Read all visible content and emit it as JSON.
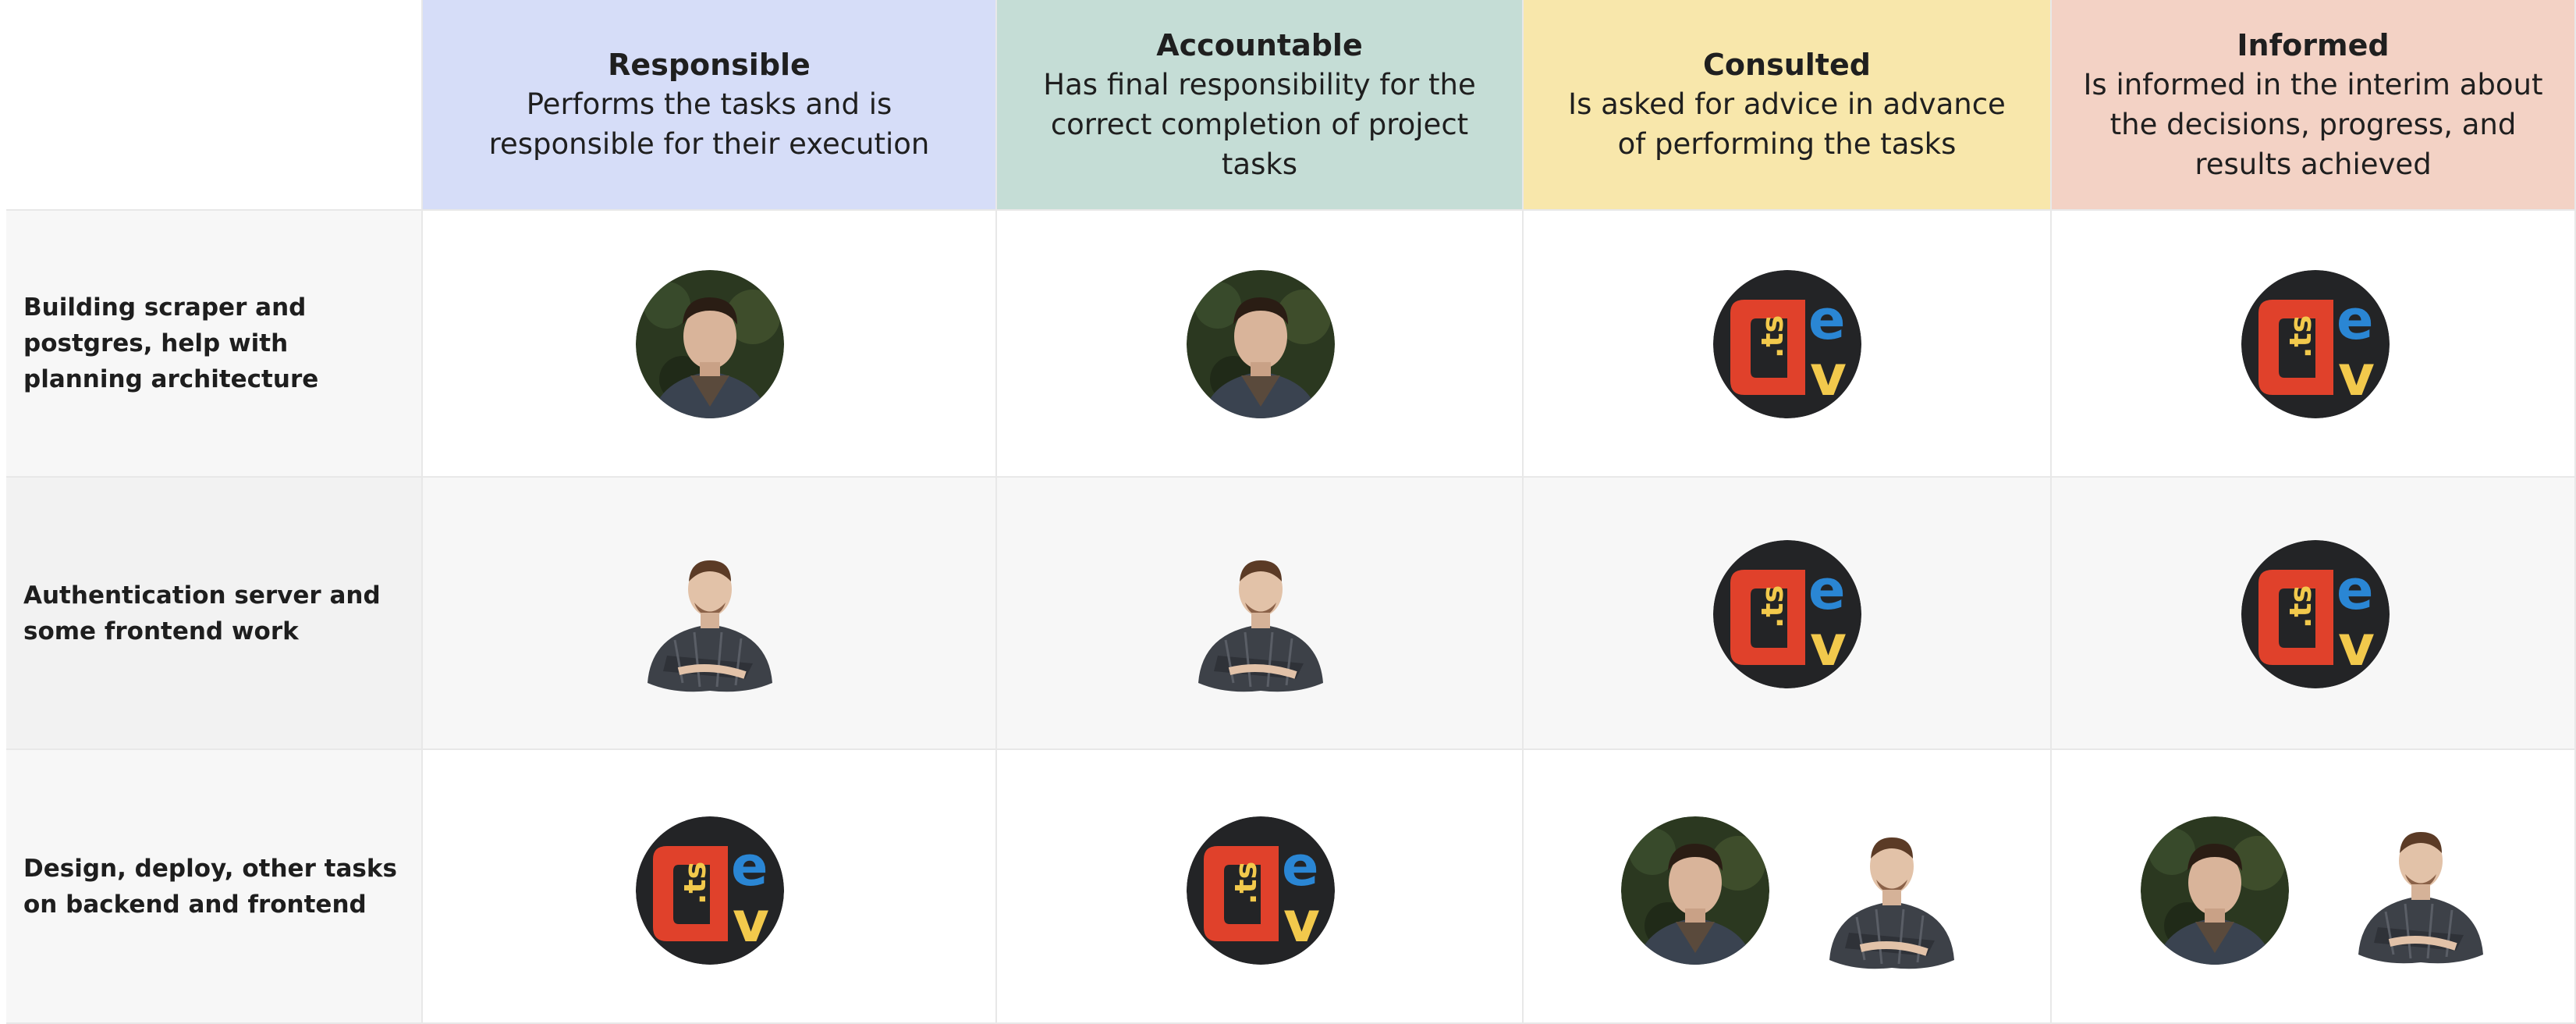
{
  "matrix": {
    "columns": [
      {
        "title": "Responsible",
        "description": "Performs the tasks and is responsible for their execution"
      },
      {
        "title": "Accountable",
        "description": "Has final responsibility for the correct completion of project tasks"
      },
      {
        "title": "Consulted",
        "description": "Is asked for advice in advance of performing the tasks"
      },
      {
        "title": "Informed",
        "description": "Is informed in the interim about the decisions, progress, and results achieved"
      }
    ],
    "rows": [
      {
        "task": "Building scraper and postgres, help with planning architecture"
      },
      {
        "task": "Authentication server and some frontend work"
      },
      {
        "task": "Design, deploy, other tasks on backend and frontend"
      }
    ],
    "logo": {
      "text_ts": ".ts",
      "text_e": "e",
      "text_v": "v"
    }
  },
  "colors": {
    "responsible": "#d6ddf8",
    "accountable": "#c5ddd6",
    "consulted": "#f8e7ab",
    "informed": "#f3d2c5",
    "logo_red": "#e0412b",
    "logo_blue": "#2a86d4",
    "logo_yellow": "#f2c94c"
  }
}
